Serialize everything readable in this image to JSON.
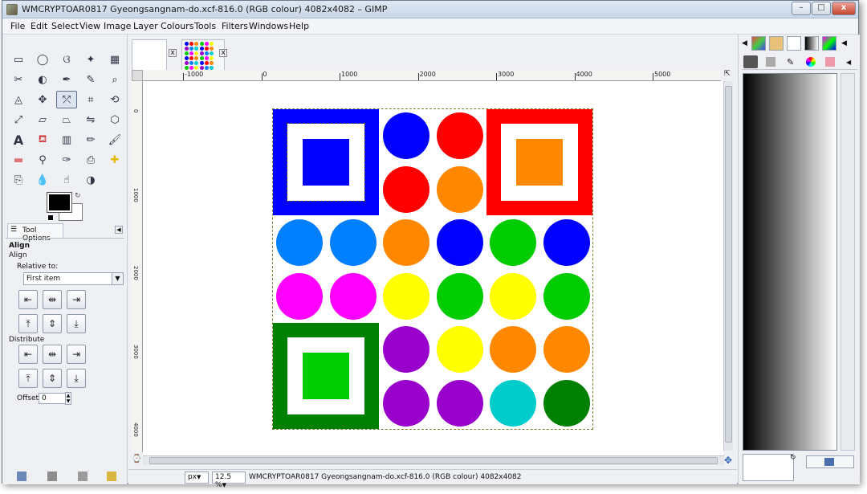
{
  "window": {
    "title": "WMCRYPTOAR0817 Gyeongsangnam-do.xcf-816.0 (RGB colour) 4082x4082 – GIMP",
    "minimize_glyph": "–",
    "maximize_glyph": "□",
    "close_glyph": "x"
  },
  "menu": [
    "File",
    "Edit",
    "Select",
    "View",
    "Image",
    "Layer",
    "Colours",
    "Tools",
    "Filters",
    "Windows",
    "Help"
  ],
  "toolbox": {
    "tool_icons": [
      "rect-select-icon",
      "ellipse-select-icon",
      "free-select-icon",
      "fuzzy-select-icon",
      "select-by-color-icon",
      "scissors-select-icon",
      "foreground-select-icon",
      "paths-icon",
      "color-picker-icon",
      "zoom-icon",
      "measure-icon",
      "move-icon",
      "align-icon",
      "crop-icon",
      "rotate-icon",
      "scale-icon",
      "shear-icon",
      "perspective-icon",
      "flip-icon",
      "cage-icon",
      "text-icon",
      "bucket-fill-icon",
      "blend-icon",
      "pencil-icon",
      "paintbrush-icon",
      "eraser-icon",
      "airbrush-icon",
      "ink-icon",
      "clone-icon",
      "heal-icon",
      "perspective-clone-icon",
      "blur-icon",
      "smudge-icon",
      "dodge-burn-icon"
    ],
    "active_tool": "align-icon",
    "fg_color": "#000000",
    "bg_color": "#ffffff"
  },
  "tool_options": {
    "tab_label": "Tool Options",
    "heading": "Align",
    "subheading": "Align",
    "relative_to_label": "Relative to:",
    "relative_to_value": "First item",
    "distribute_label": "Distribute",
    "offset_label": "Offset:",
    "offset_value": "0",
    "align_buttons": [
      "align-left-icon",
      "align-hcenter-icon",
      "align-right-icon",
      "align-top-icon",
      "align-vcenter-icon",
      "align-bottom-icon"
    ],
    "distribute_buttons": [
      "distribute-left-icon",
      "distribute-hcenter-icon",
      "distribute-right-icon",
      "distribute-top-icon",
      "distribute-vcenter-icon",
      "distribute-bottom-icon"
    ]
  },
  "image_tabs": [
    {
      "name": "blank-image-tab",
      "close": "x"
    },
    {
      "name": "current-image-tab",
      "close": "x"
    }
  ],
  "rulers": {
    "h_labels": [
      "-1000",
      "0",
      "1000",
      "2000",
      "3000",
      "4000",
      "5000"
    ],
    "v_labels": [
      "0",
      "1000",
      "2000",
      "3000",
      "4000"
    ]
  },
  "canvas": {
    "blue": "#0000ff",
    "red": "#ff0000",
    "orange": "#ff8800",
    "green_dark": "#008000",
    "green_light": "#00cc00",
    "azure": "#0080ff",
    "magenta": "#ff00ff",
    "yellow": "#ffff00",
    "purple": "#9900cc",
    "cyan": "#00cccc",
    "circle_rows": [
      [
        "blue",
        "red"
      ],
      [
        "red",
        "orange"
      ],
      [
        "azure",
        "azure",
        "orange",
        "blue",
        "green_light",
        "blue"
      ],
      [
        "magenta",
        "magenta",
        "yellow",
        "green_light",
        "yellow",
        "green_light"
      ],
      [
        "purple",
        "yellow",
        "orange",
        "orange"
      ],
      [
        "purple",
        "purple",
        "cyan",
        "green_dark"
      ]
    ]
  },
  "statusbar": {
    "unit": "px",
    "zoom": "12.5 %",
    "info": "WMCRYPTOAR0817 Gyeongsangnam-do.xcf-816.0 (RGB colour) 4082x4082"
  },
  "dock": {
    "tab_icons": [
      "brushes-icon",
      "patterns-icon",
      "fonts-icon",
      "gradients-icon",
      "palettes-icon"
    ],
    "sub_icons": [
      "view-mode-icon",
      "layer-stack-icon",
      "brush-small-icon",
      "colors-icon",
      "image-icon"
    ]
  }
}
